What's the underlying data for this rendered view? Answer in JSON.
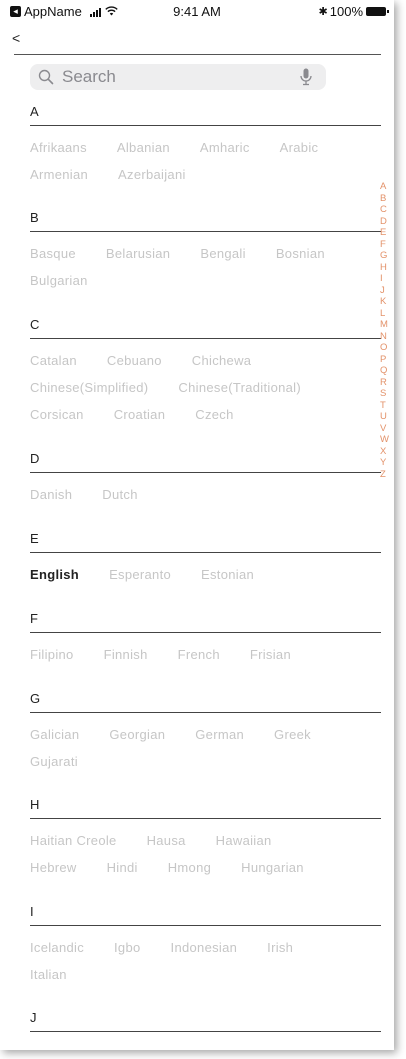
{
  "status_bar": {
    "app_name": "AppName",
    "time": "9:41 AM",
    "bluetooth": "✱",
    "battery": "100%"
  },
  "nav": {
    "back_label": "<"
  },
  "search": {
    "placeholder": "Search"
  },
  "sections": [
    {
      "letter": "A",
      "rows": [
        [
          "Afrikaans",
          "Albanian",
          "Amharic",
          "Arabic"
        ],
        [
          "Armenian",
          "Azerbaijani"
        ]
      ]
    },
    {
      "letter": "B",
      "rows": [
        [
          "Basque",
          "Belarusian",
          "Bengali",
          "Bosnian"
        ],
        [
          "Bulgarian"
        ]
      ]
    },
    {
      "letter": "C",
      "rows": [
        [
          "Catalan",
          "Cebuano",
          "Chichewa"
        ],
        [
          "Chinese(Simplified)",
          "Chinese(Traditional)"
        ],
        [
          "Corsican",
          "Croatian",
          "Czech"
        ]
      ]
    },
    {
      "letter": "D",
      "rows": [
        [
          "Danish",
          "Dutch"
        ]
      ]
    },
    {
      "letter": "E",
      "rows": [
        [
          "English",
          "Esperanto",
          "Estonian"
        ]
      ]
    },
    {
      "letter": "F",
      "rows": [
        [
          "Filipino",
          "Finnish",
          "French",
          "Frisian"
        ]
      ]
    },
    {
      "letter": "G",
      "rows": [
        [
          "Galician",
          "Georgian",
          "German",
          "Greek"
        ],
        [
          "Gujarati"
        ]
      ]
    },
    {
      "letter": "H",
      "rows": [
        [
          "Haitian Creole",
          "Hausa",
          "Hawaiian"
        ],
        [
          "Hebrew",
          "Hindi",
          "Hmong",
          "Hungarian"
        ]
      ]
    },
    {
      "letter": "I",
      "rows": [
        [
          "Icelandic",
          "Igbo",
          "Indonesian",
          "Irish"
        ],
        [
          "Italian"
        ]
      ]
    },
    {
      "letter": "J",
      "rows": []
    }
  ],
  "selected_language": "English",
  "alphabet_index": [
    "A",
    "B",
    "C",
    "D",
    "E",
    "F",
    "G",
    "H",
    "I",
    "J",
    "K",
    "L",
    "M",
    "N",
    "O",
    "P",
    "Q",
    "R",
    "S",
    "T",
    "U",
    "V",
    "W",
    "X",
    "Y",
    "Z"
  ],
  "colors": {
    "index_accent": "#e3926a",
    "inactive_language": "#c6c6c6",
    "active_language": "#222222"
  }
}
